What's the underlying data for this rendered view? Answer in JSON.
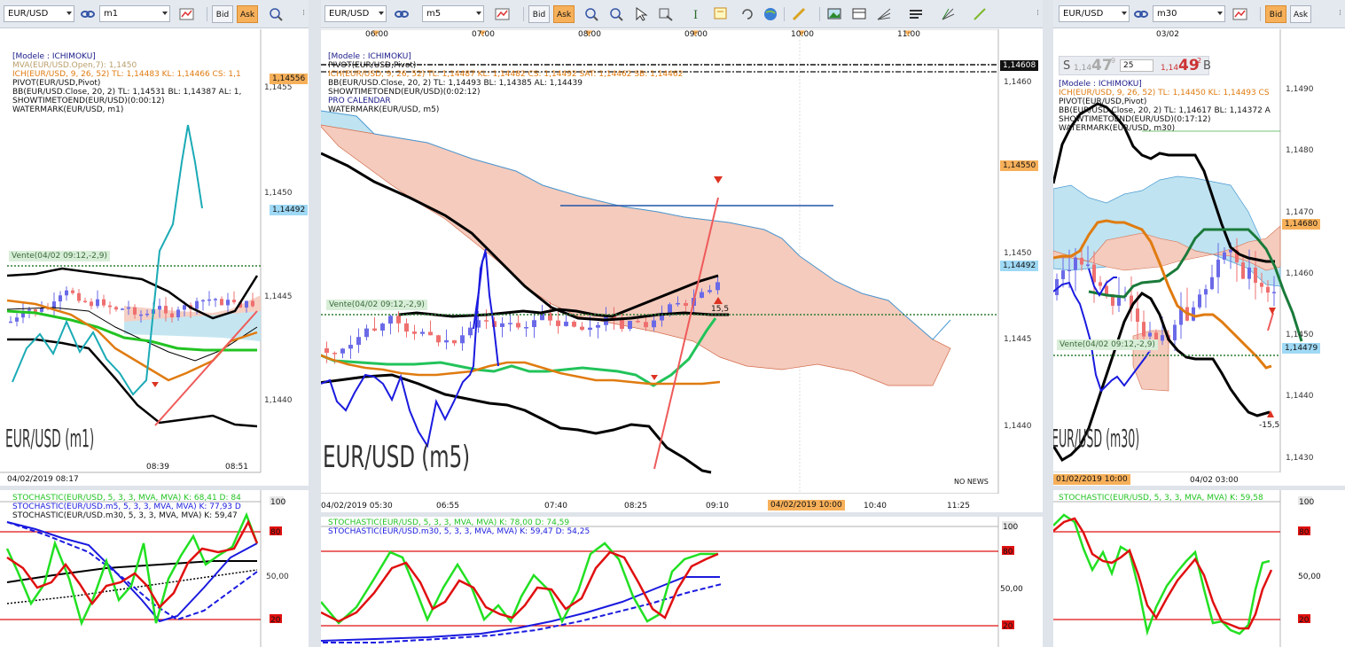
{
  "panels": [
    {
      "symbol": "EUR/USD",
      "timeframe": "m1",
      "bid": "Bid",
      "ask": "Ask",
      "active": "ask",
      "legend": [
        {
          "t": "[Modele : ICHIMOKU]",
          "c": "#1a1a8a"
        },
        {
          "t": "MVA(EUR/USD.Open,7): 1,1450",
          "c": "#b99e6a"
        },
        {
          "t": "ICH(EUR/USD, 9, 26, 52)  TL: 1,14483  KL: 1,14466  CS: 1,1",
          "c": "#e07b10"
        },
        {
          "t": "PIVOT(EUR/USD,Pivot)",
          "c": "#111"
        },
        {
          "t": "BB(EUR/USD.Close, 20, 2)  TL: 1,14531  BL: 1,14387  AL: 1,",
          "c": "#111"
        },
        {
          "t": "SHOWTIMETOEND(EUR/USD)(0:00:12)",
          "c": "#111"
        },
        {
          "t": "WATERMARK(EUR/USD, m1)",
          "c": "#111"
        }
      ],
      "price_axis": [
        "1,1455",
        "1,1450",
        "1,1445",
        "1,1440"
      ],
      "price_tags": [
        {
          "v": "1,14556",
          "bg": "#f7b05a",
          "fg": "#111"
        },
        {
          "v": "1,14492",
          "bg": "#9fd9f5",
          "fg": "#111"
        }
      ],
      "order": "Vente(04/02 09:12,-2,9)",
      "watermark": "EUR/USD (m1)",
      "time_axis": [
        "04/02/2019 08:17",
        "08:39",
        "08:51"
      ],
      "stoch": [
        {
          "t": "STOCHASTIC(EUR/USD, 5, 3, 3, MVA, MVA)  K: 68,41  D: 84",
          "c": "#22c322"
        },
        {
          "t": "STOCHASTIC(EUR/USD.m5, 5, 3, 3, MVA, MVA)  K: 77,93  D",
          "c": "#1a1adf"
        },
        {
          "t": "STOCHASTIC(EUR/USD.m30, 5, 3, 3, MVA, MVA)  K: 59,47",
          "c": "#111"
        }
      ],
      "stoch_axis": [
        "100",
        "80",
        "50,00",
        "20"
      ]
    },
    {
      "symbol": "EUR/USD",
      "timeframe": "m5",
      "bid": "Bid",
      "ask": "Ask",
      "active": "ask",
      "top_times": [
        "06:00",
        "07:00",
        "08:00",
        "09:00",
        "10:00",
        "11:00"
      ],
      "legend": [
        {
          "t": "[Modele : ICHIMOKU]",
          "c": "#1a1a8a"
        },
        {
          "t": "PIVOT(EUR/USD,Pivot)",
          "c": "#111"
        },
        {
          "t": "ICH(EUR/USD, 9, 26, 52)  TL: 1,14487  KL: 1,14482  CS: 1,14492  SAT: 1,14462  SB: 1,14462",
          "c": "#e07b10"
        },
        {
          "t": "BB(EUR/USD.Close, 20, 2)  TL: 1,14493  BL: 1,14385  AL: 1,14439",
          "c": "#111"
        },
        {
          "t": "SHOWTIMETOEND(EUR/USD)(0:02:12)",
          "c": "#111"
        },
        {
          "t": "PRO CALENDAR",
          "c": "#1a1a8a"
        },
        {
          "t": "WATERMARK(EUR/USD, m5)",
          "c": "#111"
        }
      ],
      "price_axis": [
        "1,1460",
        "1,1455",
        "1,1450",
        "1,1445",
        "1,1440"
      ],
      "price_tags": [
        {
          "v": "1,14608",
          "bg": "#111",
          "fg": "#fff"
        },
        {
          "v": "1,14550",
          "bg": "#f7b05a",
          "fg": "#111"
        },
        {
          "v": "1,14492",
          "bg": "#9fd9f5",
          "fg": "#111"
        }
      ],
      "order": "Vente(04/02 09:12,-2,9)",
      "order_value": "15,5",
      "watermark": "EUR/USD (m5)",
      "no_news": "NO NEWS",
      "time_axis": [
        "04/02/2019 05:30",
        "06:55",
        "07:40",
        "08:25",
        "09:10",
        "10:40",
        "11:25"
      ],
      "time_highlight": "04/02/2019 10:00",
      "stoch": [
        {
          "t": "STOCHASTIC(EUR/USD, 5, 3, 3, MVA, MVA)  K: 78,00  D: 74,59",
          "c": "#22c322"
        },
        {
          "t": "STOCHASTIC(EUR/USD.m30, 5, 3, 3, MVA, MVA)  K: 59,47  D: 54,25",
          "c": "#1a1adf"
        }
      ],
      "stoch_axis": [
        "100",
        "80",
        "50,00",
        "20"
      ]
    },
    {
      "symbol": "EUR/USD",
      "timeframe": "m30",
      "bid": "Bid",
      "ask": "Ask",
      "active": "bid",
      "top_times": [
        "03/02"
      ],
      "quote": {
        "s": "S",
        "sell_small": "1,14",
        "sell_big": "47",
        "sell_sup": "9",
        "lots": "25",
        "buy_small": "1,14",
        "buy_big": "49",
        "buy_sup": "2",
        "b": "B"
      },
      "legend": [
        {
          "t": "[Modele : ICHIMOKU]",
          "c": "#1a1a8a"
        },
        {
          "t": "ICH(EUR/USD, 9, 26, 52)  TL: 1,14450  KL: 1,14493  CS",
          "c": "#e07b10"
        },
        {
          "t": "PIVOT(EUR/USD,Pivot)",
          "c": "#111"
        },
        {
          "t": "BB(EUR/USD.Close, 20, 2)  TL: 1,14617  BL: 1,14372  A",
          "c": "#111"
        },
        {
          "t": "SHOWTIMETOEND(EUR/USD)(0:17:12)",
          "c": "#111"
        },
        {
          "t": "WATERMARK(EUR/USD, m30)",
          "c": "#111"
        }
      ],
      "price_axis": [
        "1,1490",
        "1,1480",
        "1,1470",
        "1,1460",
        "1,1450",
        "1,1440",
        "1,1430"
      ],
      "price_tags": [
        {
          "v": "1,14680",
          "bg": "#f7b05a",
          "fg": "#111"
        },
        {
          "v": "1,14479",
          "bg": "#9fd9f5",
          "fg": "#111"
        }
      ],
      "order": "Vente(04/02 09:12,-2,9)",
      "order_value": "-15,5",
      "watermark": "EUR/USD (m30)",
      "time_axis": [
        "01/02/2019 10:00",
        "04/02 03:00"
      ],
      "stoch": [
        {
          "t": "STOCHASTIC(EUR/USD, 5, 3, 3, MVA, MVA)  K: 59,58",
          "c": "#22c322"
        }
      ],
      "stoch_axis": [
        "100",
        "80",
        "50,00",
        "20"
      ]
    }
  ],
  "colors": {
    "kumo_bear": "#f4cbbd",
    "kumo_bull": "#bfe3f0",
    "kijun": "#e07b10",
    "tenkan": "#22c35a",
    "bb": "#000000",
    "chikou": "#1a1adf",
    "mva": "#1aaab5",
    "pivot": "#111111",
    "order": "#2e7d32",
    "stoch_k": "#22e022",
    "stoch_d": "#e01010",
    "level": "#e01010"
  },
  "icons": [
    "link-icon",
    "indicator-icon",
    "crosshair-icon",
    "zoom-icon",
    "cursor-icon",
    "magnifier-icon",
    "text-icon",
    "note-icon",
    "rotate-icon",
    "globe-icon",
    "ruler-icon",
    "image-icon",
    "layout-icon",
    "fan-icon",
    "lines-icon",
    "pitchfork-icon",
    "trendline-icon",
    "grip-icon"
  ]
}
